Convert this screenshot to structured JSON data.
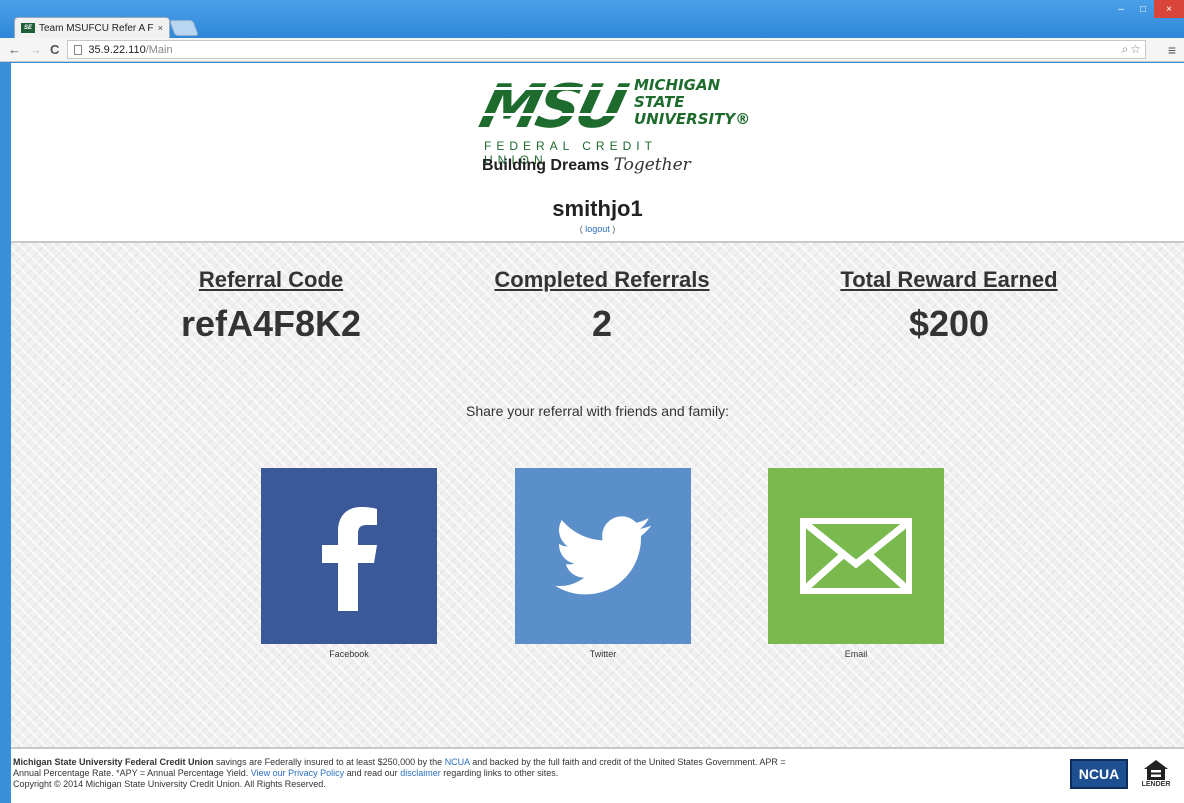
{
  "browser": {
    "tab_title": "Team MSUFCU Refer A Fri",
    "tab_close": "×",
    "favicon_text": "SE",
    "url_host": "35.9.22.110",
    "url_path": "/Main",
    "back": "←",
    "forward": "→",
    "reload": "C",
    "minimize": "–",
    "maximize": "□",
    "close": "×",
    "zoom_icon": "⌕",
    "star_icon": "☆",
    "menu_icon": "≡"
  },
  "header": {
    "logo_msu": "MSU",
    "logo_name_line1": "Michigan",
    "logo_name_line2": "State",
    "logo_name_line3": "University®",
    "logo_fcu": "FEDERAL CREDIT UNION",
    "tagline_main": "Building Dreams",
    "tagline_script": "Together",
    "username": "smithjo1",
    "logout_open": "( ",
    "logout_label": "logout",
    "logout_close": " )"
  },
  "stats": {
    "referral_code_label": "Referral Code",
    "referral_code_value": "refA4F8K2",
    "completed_label": "Completed Referrals",
    "completed_value": "2",
    "reward_label": "Total Reward Earned",
    "reward_value": "$200"
  },
  "share": {
    "prompt": "Share your referral with friends and family:",
    "facebook_label": "Facebook",
    "twitter_label": "Twitter",
    "email_label": "Email",
    "colors": {
      "facebook": "#3b5998",
      "twitter": "#5b8fc9",
      "email": "#79b94d"
    }
  },
  "footer": {
    "org_name": "Michigan State University Federal Credit Union",
    "text1": " savings are Federally insured to at least $250,000 by the ",
    "ncua_link": "NCUA",
    "text2": " and backed by the full faith and credit of the United States Government. APR = Annual Percentage Rate. *APY = Annual Percentage Yield. ",
    "privacy_link": "View our Privacy Policy",
    "text3": " and read our ",
    "disclaimer_link": "disclaimer",
    "text4": " regarding links to other sites.",
    "copyright": "Copyright © 2014 Michigan State University Credit Union. All Rights Reserved.",
    "ncua_badge": "NCUA",
    "equal_housing": "LENDER"
  },
  "colors": {
    "brand_green": "#1e6b2e",
    "link_blue": "#2a6fc0"
  }
}
